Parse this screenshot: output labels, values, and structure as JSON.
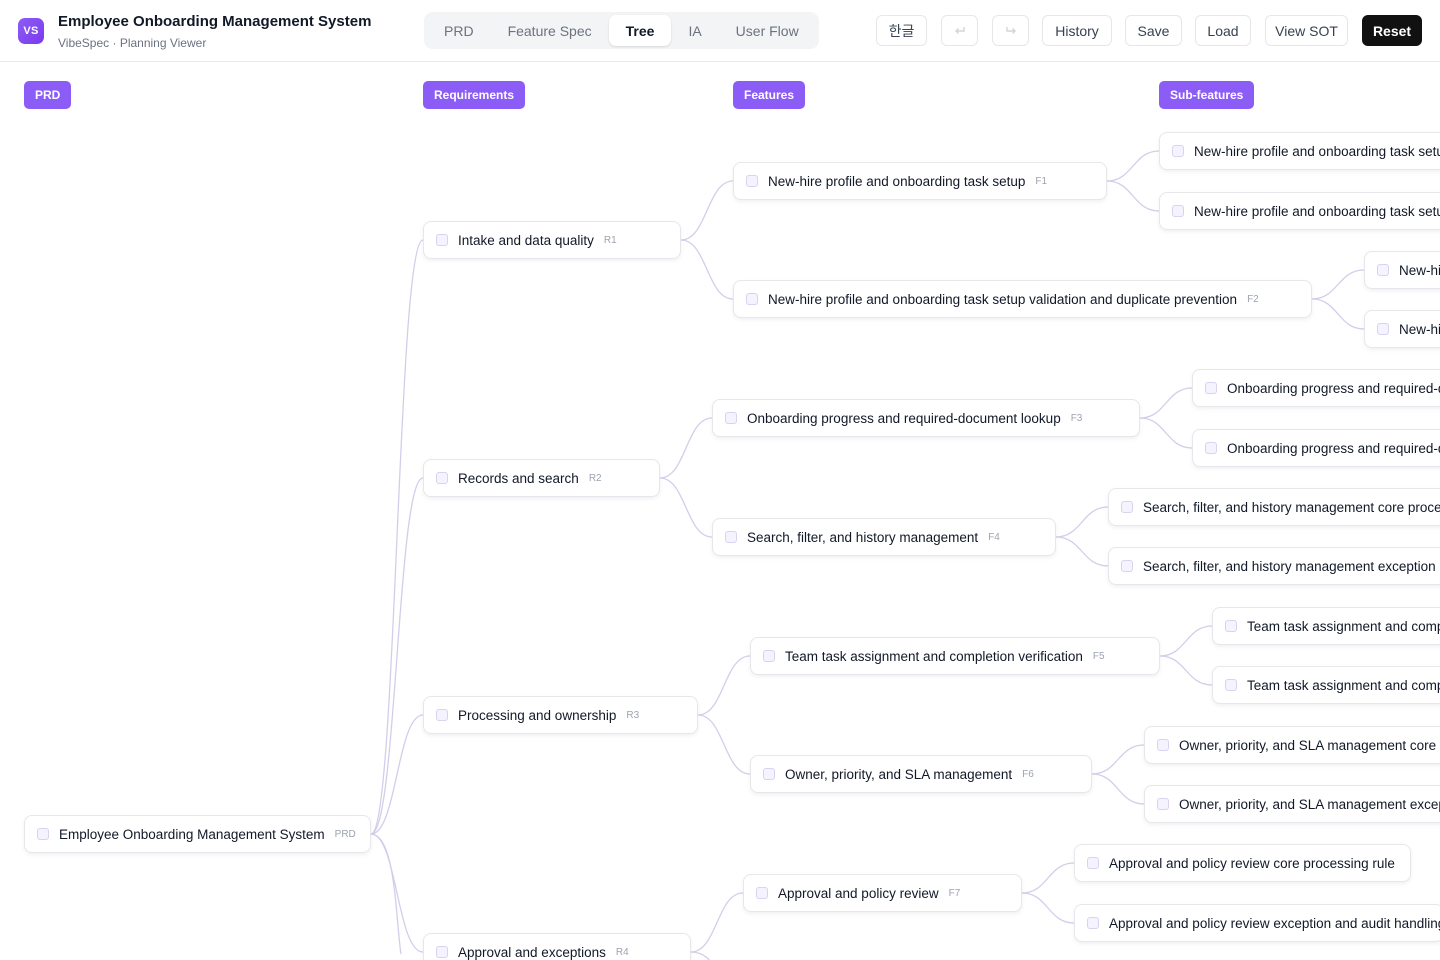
{
  "header": {
    "logo": "VS",
    "title": "Employee Onboarding Management System",
    "subtitle": "VibeSpec · Planning Viewer",
    "tabs": [
      "PRD",
      "Feature Spec",
      "Tree",
      "IA",
      "User Flow"
    ],
    "active_tab": "Tree",
    "buttons": {
      "language": "한글",
      "undo_icon": "undo-icon",
      "redo_icon": "redo-icon",
      "history": "History",
      "save": "Save",
      "load": "Load",
      "view_sot": "View SOT",
      "reset": "Reset"
    }
  },
  "colors": {
    "accent": "#8b5cf6",
    "link": "#d4cdea",
    "reset_button": "#111111"
  },
  "columns": [
    "PRD",
    "Requirements",
    "Features",
    "Sub-features"
  ],
  "tree": {
    "root": {
      "label": "Employee Onboarding Management System",
      "code": "PRD"
    },
    "requirements": [
      {
        "label": "Intake and data quality",
        "code": "R1"
      },
      {
        "label": "Records and search",
        "code": "R2"
      },
      {
        "label": "Processing and ownership",
        "code": "R3"
      },
      {
        "label": "Approval and exceptions",
        "code": "R4"
      }
    ],
    "features": [
      {
        "label": "New-hire profile and onboarding task setup",
        "code": "F1"
      },
      {
        "label": "New-hire profile and onboarding task setup validation and duplicate prevention",
        "code": "F2"
      },
      {
        "label": "Onboarding progress and required-document lookup",
        "code": "F3"
      },
      {
        "label": "Search, filter, and history management",
        "code": "F4"
      },
      {
        "label": "Team task assignment and completion verification",
        "code": "F5"
      },
      {
        "label": "Owner, priority, and SLA management",
        "code": "F6"
      },
      {
        "label": "Approval and policy review",
        "code": "F7"
      }
    ],
    "subfeatures": [
      {
        "label": "New-hire profile and onboarding task setup"
      },
      {
        "label": "New-hire profile and onboarding task setup"
      },
      {
        "label": "New-hi"
      },
      {
        "label": "New-hi"
      },
      {
        "label": "Onboarding progress and required-do"
      },
      {
        "label": "Onboarding progress and required-do"
      },
      {
        "label": "Search, filter, and history management core processi"
      },
      {
        "label": "Search, filter, and history management exception an"
      },
      {
        "label": "Team task assignment and comple"
      },
      {
        "label": "Team task assignment and comple"
      },
      {
        "label": "Owner, priority, and SLA management core pro"
      },
      {
        "label": "Owner, priority, and SLA management exceptio"
      },
      {
        "label": "Approval and policy review core processing rule"
      },
      {
        "label": "Approval and policy review exception and audit handling"
      }
    ]
  }
}
